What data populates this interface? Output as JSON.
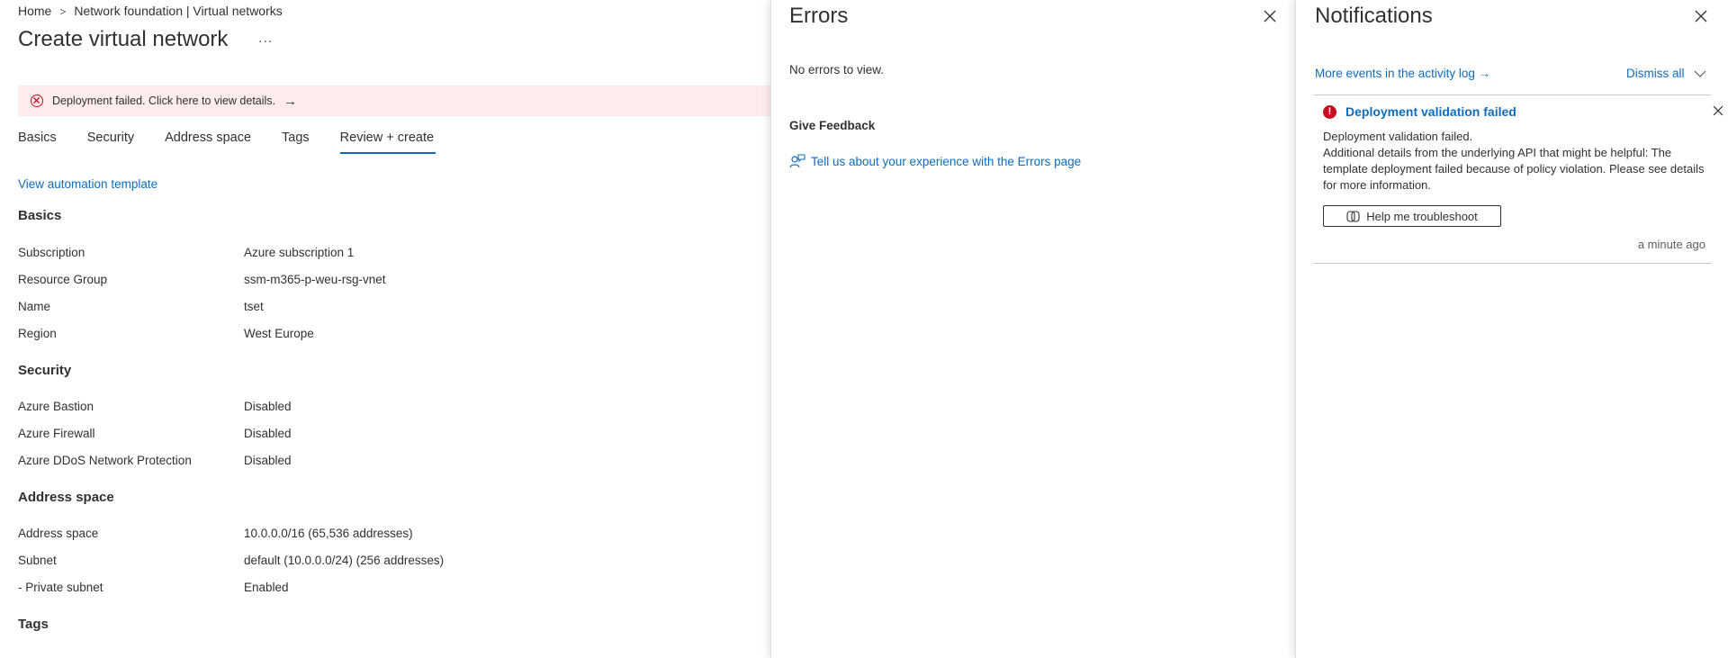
{
  "breadcrumb": {
    "items": [
      "Home",
      "Network foundation | Virtual networks"
    ],
    "separator": ">"
  },
  "page": {
    "title": "Create virtual network",
    "more_label": "..."
  },
  "banner": {
    "text": "Deployment failed. Click here to view details.",
    "arrow": "→"
  },
  "tabs": [
    {
      "label": "Basics",
      "active": false
    },
    {
      "label": "Security",
      "active": false
    },
    {
      "label": "Address space",
      "active": false
    },
    {
      "label": "Tags",
      "active": false
    },
    {
      "label": "Review + create",
      "active": true
    }
  ],
  "automation_link": "View automation template",
  "sections": [
    {
      "title": "Basics",
      "rows": [
        {
          "label": "Subscription",
          "value": "Azure subscription 1"
        },
        {
          "label": "Resource Group",
          "value": "ssm-m365-p-weu-rsg-vnet"
        },
        {
          "label": "Name",
          "value": "tset"
        },
        {
          "label": "Region",
          "value": "West Europe"
        }
      ]
    },
    {
      "title": "Security",
      "rows": [
        {
          "label": "Azure Bastion",
          "value": "Disabled"
        },
        {
          "label": "Azure Firewall",
          "value": "Disabled"
        },
        {
          "label": "Azure DDoS Network Protection",
          "value": "Disabled"
        }
      ]
    },
    {
      "title": "Address space",
      "rows": [
        {
          "label": "Address space",
          "value": "10.0.0.0/16 (65,536 addresses)"
        },
        {
          "label": "Subnet",
          "value": "default (10.0.0.0/24) (256 addresses)"
        },
        {
          "label": "- Private subnet",
          "value": "Enabled"
        }
      ]
    },
    {
      "title": "Tags",
      "rows": []
    }
  ],
  "errors_panel": {
    "title": "Errors",
    "no_errors_text": "No errors to view.",
    "feedback_title": "Give Feedback",
    "feedback_link": "Tell us about your experience with the Errors page"
  },
  "notifications_panel": {
    "title": "Notifications",
    "activity_link": "More events in the activity log →",
    "dismiss_label": "Dismiss all",
    "notification": {
      "status_icon": "!",
      "title": "Deployment validation failed",
      "line1": "Deployment validation failed.",
      "line2": "Additional details from the underlying API that might be helpful: The template deployment failed because of policy violation. Please see details for more information.",
      "button_label": "Help me troubleshoot",
      "time": "a minute ago"
    }
  },
  "colors": {
    "accent": "#0f6cbd",
    "error": "#c50f1f",
    "banner_bg": "#fdeceb"
  }
}
